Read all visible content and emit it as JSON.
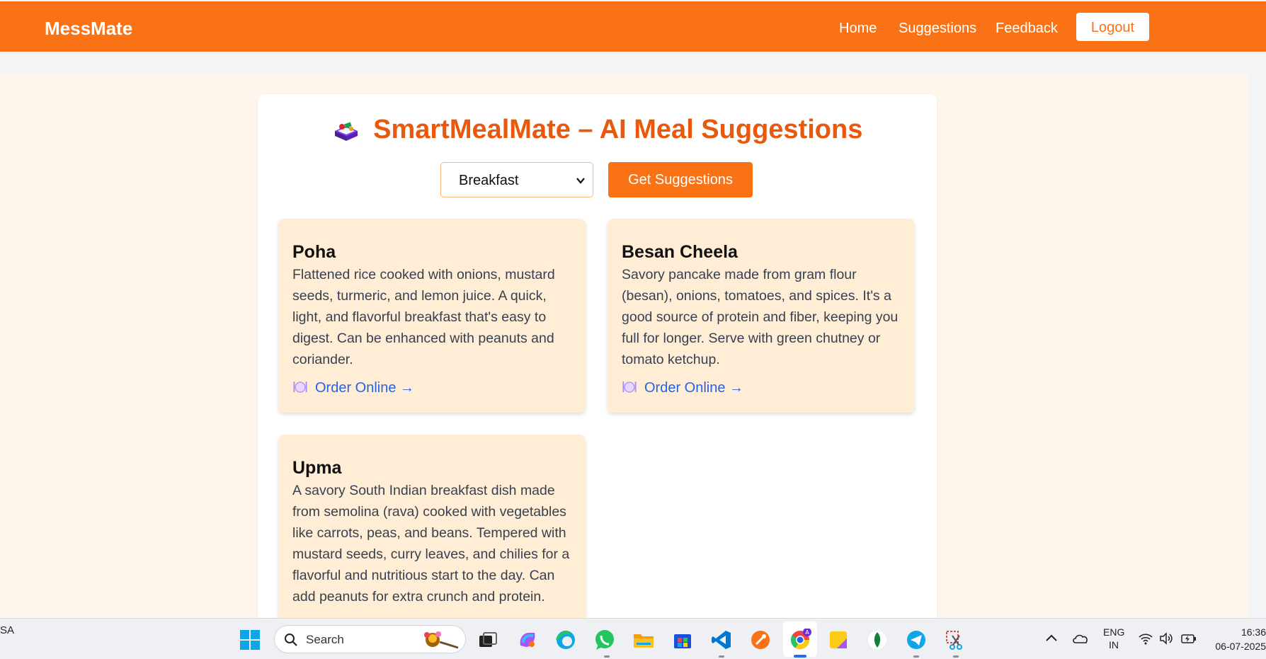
{
  "navbar": {
    "brand": "MessMate",
    "links": [
      "Home",
      "Suggestions",
      "Feedback"
    ],
    "logout_label": "Logout"
  },
  "main": {
    "title": "SmartMealMate – AI Meal Suggestions",
    "title_icon": "bento-box-icon",
    "select": {
      "value": "Breakfast"
    },
    "get_button": "Get Suggestions",
    "meals": [
      {
        "name": "Poha",
        "description": "Flattened rice cooked with onions, mustard seeds, turmeric, and lemon juice. A quick, light, and flavorful breakfast that's easy to digest. Can be enhanced with peanuts and coriander.",
        "link": "Order Online →"
      },
      {
        "name": "Besan Cheela",
        "description": "Savory pancake made from gram flour (besan), onions, tomatoes, and spices. It's a good source of protein and fiber, keeping you full for longer. Serve with green chutney or tomato ketchup.",
        "link": "Order Online →"
      },
      {
        "name": "Upma",
        "description": "A savory South Indian breakfast dish made from semolina (rava) cooked with vegetables like carrots, peas, and beans. Tempered with mustard seeds, curry leaves, and chilies for a flavorful and nutritious start to the day. Can add peanuts for extra crunch and protein."
      }
    ]
  },
  "colors": {
    "accent": "#f97316",
    "title": "#ea580c",
    "card_bg": "#ffedd5",
    "page_bg": "#fff7ed",
    "link": "#2563eb"
  },
  "taskbar": {
    "left_text": "SA",
    "search_placeholder": "Search",
    "lang_line1": "ENG",
    "lang_line2": "IN",
    "time": "16:36",
    "date": "06-07-2025"
  }
}
